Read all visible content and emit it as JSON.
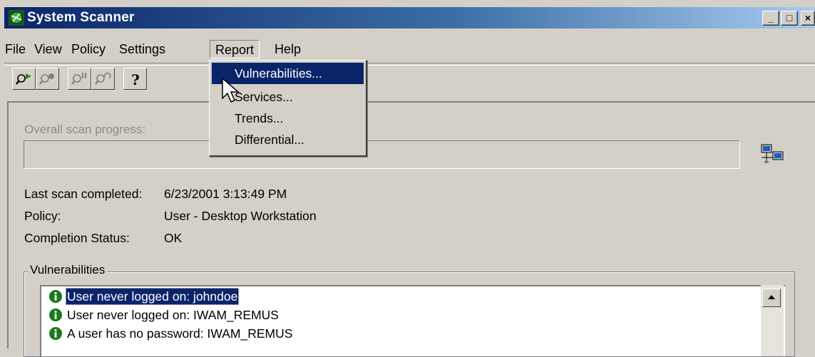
{
  "window": {
    "title": "System Scanner",
    "controls": {
      "minimize": "_",
      "maximize": "□",
      "close": "×"
    }
  },
  "menubar": {
    "items": [
      "File",
      "View",
      "Policy",
      "Settings",
      "Report",
      "Help"
    ],
    "open_menu": "Report"
  },
  "report_menu": {
    "items": [
      "Vulnerabilities...",
      "Services...",
      "Trends...",
      "Differential..."
    ],
    "highlighted": "Vulnerabilities..."
  },
  "toolbar": {
    "buttons": [
      "scan-start-icon",
      "scan-stop-icon",
      "pause-icon",
      "refresh-scan-icon",
      "help-icon"
    ],
    "help_glyph": "?"
  },
  "scan": {
    "progress_label": "Overall scan progress:",
    "progress": 0
  },
  "info": {
    "last_scan_label": "Last scan completed:",
    "last_scan_value": "6/23/2001 3:13:49 PM",
    "policy_label": "Policy:",
    "policy_value": "User - Desktop Workstation",
    "status_label": "Completion Status:",
    "status_value": "OK"
  },
  "vulnerabilities": {
    "title": "Vulnerabilities",
    "items": [
      {
        "text": "User never logged on:  johndoe",
        "selected": true
      },
      {
        "text": "User never logged on:  IWAM_REMUS",
        "selected": false
      },
      {
        "text": "A user has no password:  IWAM_REMUS",
        "selected": false
      }
    ]
  },
  "colors": {
    "face": "#d4d0c8",
    "titlebar_start": "#0a246a",
    "titlebar_end": "#a6caf0",
    "highlight": "#0a246a",
    "info_icon": "#1a7a1a"
  }
}
